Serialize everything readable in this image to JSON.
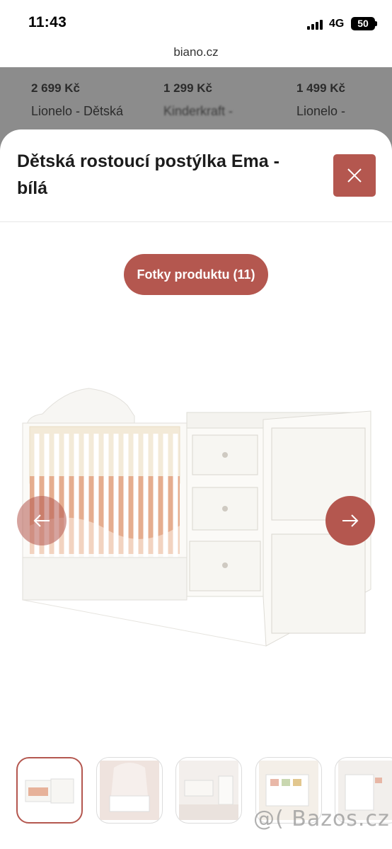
{
  "status": {
    "time": "11:43",
    "network": "4G",
    "battery": "50"
  },
  "browser": {
    "url": "biano.cz"
  },
  "background_products": [
    {
      "price": "2 699 Kč",
      "name": "Lionelo - Dětská"
    },
    {
      "price": "1 299 Kč",
      "name": "Kinderkraft -"
    },
    {
      "price": "1 499 Kč",
      "name": "Lionelo -"
    }
  ],
  "modal": {
    "title": "Dětská rostoucí postýlka Ema - bílá",
    "photos_button": "Fotky produktu (11)"
  },
  "watermark": "@( Bazos.cz",
  "colors": {
    "accent": "#b4574f",
    "backdrop": "#8c8c8c"
  }
}
